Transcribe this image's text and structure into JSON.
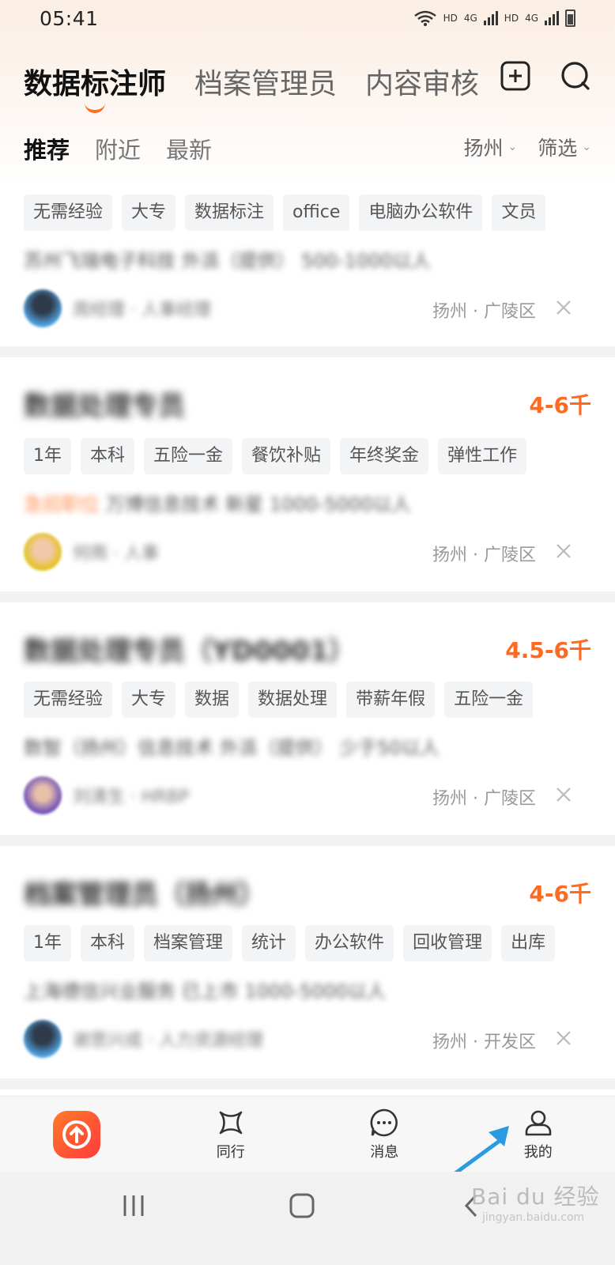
{
  "status_bar": {
    "time": "05:41",
    "network_1": "HD",
    "gen_1": "4G",
    "network_2": "HD",
    "gen_2": "4G"
  },
  "job_tabs": [
    "数据标注师",
    "档案管理员",
    "内容审核"
  ],
  "sub_tabs": [
    "推荐",
    "附近",
    "最新"
  ],
  "filters": {
    "city": "扬州",
    "filter": "筛选"
  },
  "jobs": [
    {
      "title": "",
      "salary": "",
      "tags": [
        "无需经验",
        "大专",
        "数据标注",
        "office",
        "电脑办公软件",
        "文员"
      ],
      "company": "苏州飞瑞电子科技 外派（提供） 500-1000以人",
      "company_tag": "",
      "recruiter": "周经理 · 人事经理",
      "location": "扬州 · 广陵区"
    },
    {
      "title": "数据处理专员",
      "salary": "4-6千",
      "tags": [
        "1年",
        "本科",
        "五险一金",
        "餐饮补贴",
        "年终奖金",
        "弹性工作"
      ],
      "company": "万博信息技术 新星 1000-5000以人",
      "company_tag": "急招职位",
      "recruiter": "何雨 · 人事",
      "location": "扬州 · 广陵区"
    },
    {
      "title": "数据处理专员（YD0001）",
      "salary": "4.5-6千",
      "tags": [
        "无需经验",
        "大专",
        "数据",
        "数据处理",
        "带薪年假",
        "五险一金"
      ],
      "company": "数智（扬州）信息技术 外派（提供） 少于50以人",
      "company_tag": "",
      "recruiter": "刘清生 · HRBP",
      "location": "扬州 · 广陵区"
    },
    {
      "title": "档案管理员（扬州）",
      "salary": "4-6千",
      "tags": [
        "1年",
        "本科",
        "档案管理",
        "统计",
        "办公软件",
        "回收管理",
        "出库"
      ],
      "company": "上海德信兴业服务 已上市 1000-5000以人",
      "company_tag": "",
      "recruiter": "谢思兴成 · 人力资源经理",
      "location": "扬州 · 开发区"
    }
  ],
  "bottom_nav": [
    "同行",
    "消息",
    "我的"
  ],
  "watermark": {
    "brand": "Bai du 经验",
    "url": "jingyan.baidu.com"
  },
  "colors": {
    "accent": "#ff6a1f",
    "arrow": "#2a9be0"
  }
}
